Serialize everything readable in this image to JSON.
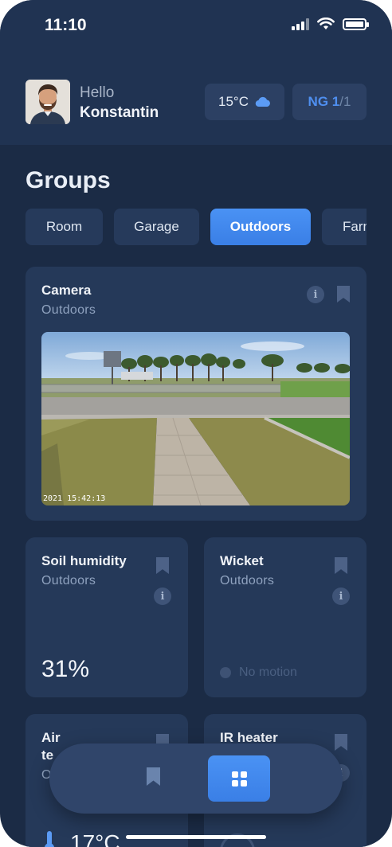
{
  "status_bar": {
    "time": "11:10",
    "icons": [
      "signal-icon",
      "wifi-icon",
      "battery-icon"
    ]
  },
  "header": {
    "greeting": "Hello",
    "user_name": "Konstantin",
    "weather": {
      "temperature": "15°C",
      "icon": "cloud-icon"
    },
    "ng": {
      "label": "NG",
      "current": "1",
      "separator": "/",
      "total": "1"
    }
  },
  "groups": {
    "title": "Groups",
    "tabs": [
      {
        "label": "Room",
        "active": false
      },
      {
        "label": "Garage",
        "active": false
      },
      {
        "label": "Outdoors",
        "active": true
      },
      {
        "label": "Farm",
        "active": false
      }
    ]
  },
  "cards": {
    "camera": {
      "title": "Camera",
      "subtitle": "Outdoors",
      "timestamp": "2021 15:42:13"
    },
    "soil": {
      "title": "Soil humidity",
      "subtitle": "Outdoors",
      "value": "31%"
    },
    "wicket": {
      "title": "Wicket",
      "subtitle": "Outdoors",
      "status": "No motion"
    },
    "air": {
      "title": "Air",
      "title_line2": "te",
      "subtitle": "O",
      "value": "17°C"
    },
    "ir": {
      "title": "IR heater"
    }
  },
  "info_glyph": "i",
  "bottom_nav": {
    "items": [
      "bookmark-icon",
      "dashboard-icon"
    ],
    "active": "dashboard-icon"
  },
  "colors": {
    "accent": "#3a7fe6",
    "background": "#1b2b45",
    "card": "#253959",
    "header": "#203352"
  }
}
